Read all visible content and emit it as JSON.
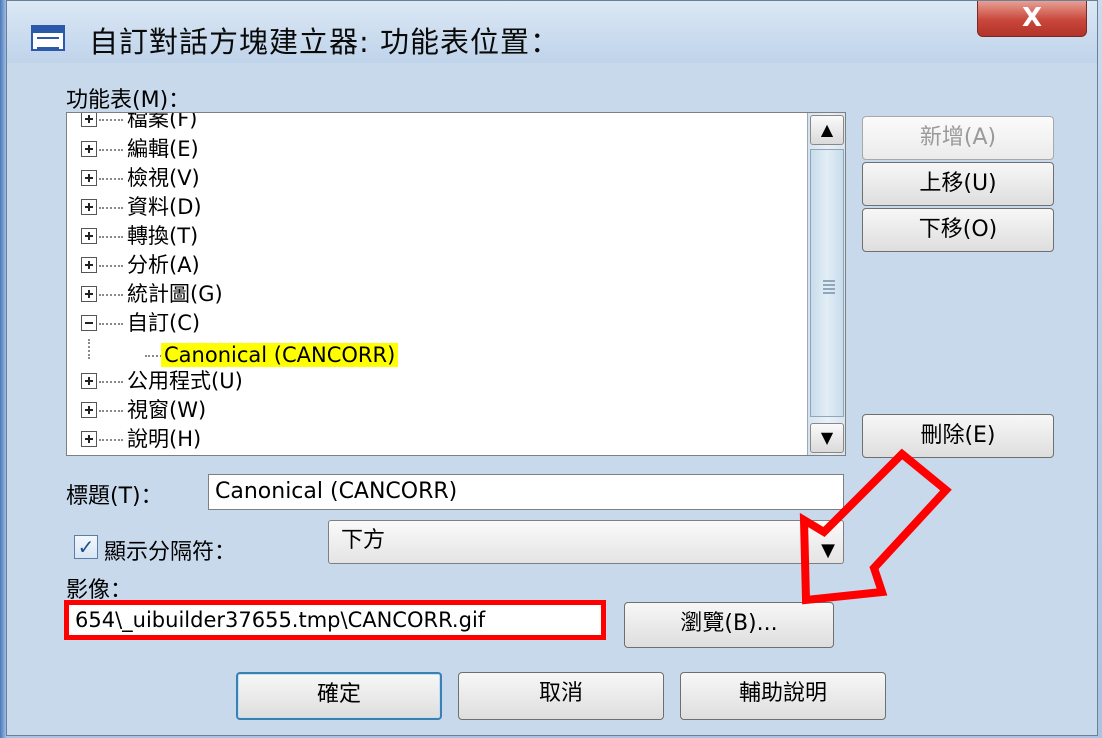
{
  "window": {
    "title": "自訂對話方塊建立器: 功能表位置：",
    "close_label": "X"
  },
  "menu_label": "功能表(M)：",
  "menu_tree": {
    "items": [
      {
        "label": "檔案(F)",
        "expanded": false
      },
      {
        "label": "編輯(E)",
        "expanded": false
      },
      {
        "label": "檢視(V)",
        "expanded": false
      },
      {
        "label": "資料(D)",
        "expanded": false
      },
      {
        "label": "轉換(T)",
        "expanded": false
      },
      {
        "label": "分析(A)",
        "expanded": false
      },
      {
        "label": "統計圖(G)",
        "expanded": false
      },
      {
        "label": "自訂(C)",
        "expanded": true
      },
      {
        "label": "公用程式(U)",
        "expanded": false
      },
      {
        "label": "視窗(W)",
        "expanded": false
      },
      {
        "label": "說明(H)",
        "expanded": false
      }
    ],
    "selected_child": "Canonical (CANCORR)"
  },
  "side_buttons": {
    "add": "新增(A)",
    "move_up": "上移(U)",
    "move_down": "下移(O)",
    "delete": "刪除(E)"
  },
  "title_field": {
    "label": "標題(T)：",
    "value": "Canonical (CANCORR)"
  },
  "separator": {
    "label": "顯示分隔符：",
    "checked": true,
    "position_value": "下方"
  },
  "image_field": {
    "label": "影像：",
    "value": "654\\_uibuilder37655.tmp\\CANCORR.gif",
    "browse_label": "瀏覽(B)..."
  },
  "footer_buttons": {
    "ok": "確定",
    "cancel": "取消",
    "help": "輔助說明"
  },
  "colors": {
    "highlight": "#ffff00",
    "annotation": "#ff0000"
  }
}
